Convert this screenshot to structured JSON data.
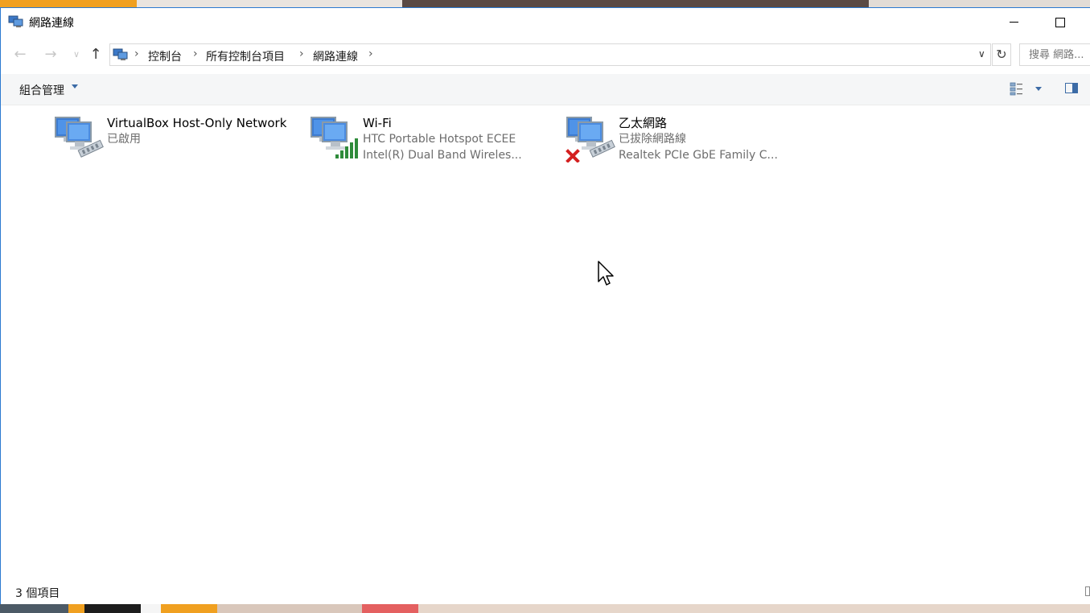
{
  "window": {
    "title": "網路連線",
    "icon": "network-connections-icon"
  },
  "nav": {
    "back_icon": "arrow-left-icon",
    "forward_icon": "arrow-right-icon",
    "recent_icon": "chevron-down-icon",
    "up_icon": "arrow-up-icon"
  },
  "address": {
    "breadcrumbs": [
      "控制台",
      "所有控制台項目",
      "網路連線"
    ]
  },
  "search": {
    "placeholder": "搜尋 網路..."
  },
  "commandbar": {
    "organize_label": "組合管理"
  },
  "items": [
    {
      "name": "VirtualBox Host-Only Network",
      "line1": "已啟用",
      "line2": "",
      "icon": "wired-network-icon",
      "overlay": "none"
    },
    {
      "name": "Wi-Fi",
      "line1": "HTC Portable Hotspot ECEE",
      "line2": "Intel(R) Dual Band Wireles...",
      "icon": "wifi-network-icon",
      "overlay": "signal-bars-icon"
    },
    {
      "name": "乙太網路",
      "line1": "已拔除網路線",
      "line2": "Realtek PCIe GbE Family C...",
      "icon": "wired-network-icon",
      "overlay": "red-x-icon"
    }
  ],
  "status": {
    "count_text": "3 個項目"
  },
  "colors": {
    "accent": "#2b79d0",
    "toolbar_bg": "#f5f6f7",
    "subtext": "#6d6d6d",
    "error_red": "#d42020",
    "signal_green": "#2e8b3a"
  }
}
